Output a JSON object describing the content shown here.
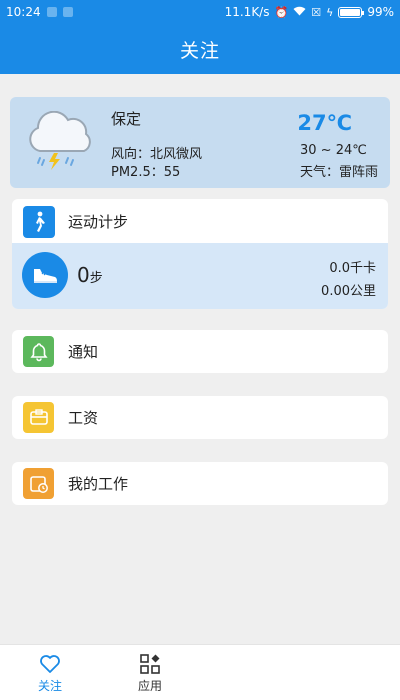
{
  "status_bar": {
    "time": "10:24",
    "speed": "11.1K/s",
    "battery": "99%",
    "battery_level": 0.99
  },
  "header": {
    "title": "关注"
  },
  "weather": {
    "city": "保定",
    "wind": "风向：北风微风",
    "pm25": "PM2.5：55",
    "temperature": "27℃",
    "range": "30 ~ 24℃",
    "condition": "天气：雷阵雨",
    "icon": "thunderstorm-cloud-icon"
  },
  "sport": {
    "title": "运动计步",
    "steps": "0",
    "steps_unit": "步",
    "calories": "0.0千卡",
    "distance": "0.00公里"
  },
  "menu": [
    {
      "label": "通知",
      "icon": "bell-icon",
      "color": "#5cb85c"
    },
    {
      "label": "工资",
      "icon": "wallet-icon",
      "color": "#f5c533"
    },
    {
      "label": "我的工作",
      "icon": "calendar-clock-icon",
      "color": "#f0a033"
    }
  ],
  "tabs": [
    {
      "label": "关注",
      "icon": "heart-icon",
      "active": true
    },
    {
      "label": "应用",
      "icon": "apps-icon",
      "active": false
    }
  ],
  "colors": {
    "primary": "#1a8ae6",
    "weather_card": "#c6dcf0",
    "steps_panel": "#d6e7f8"
  }
}
